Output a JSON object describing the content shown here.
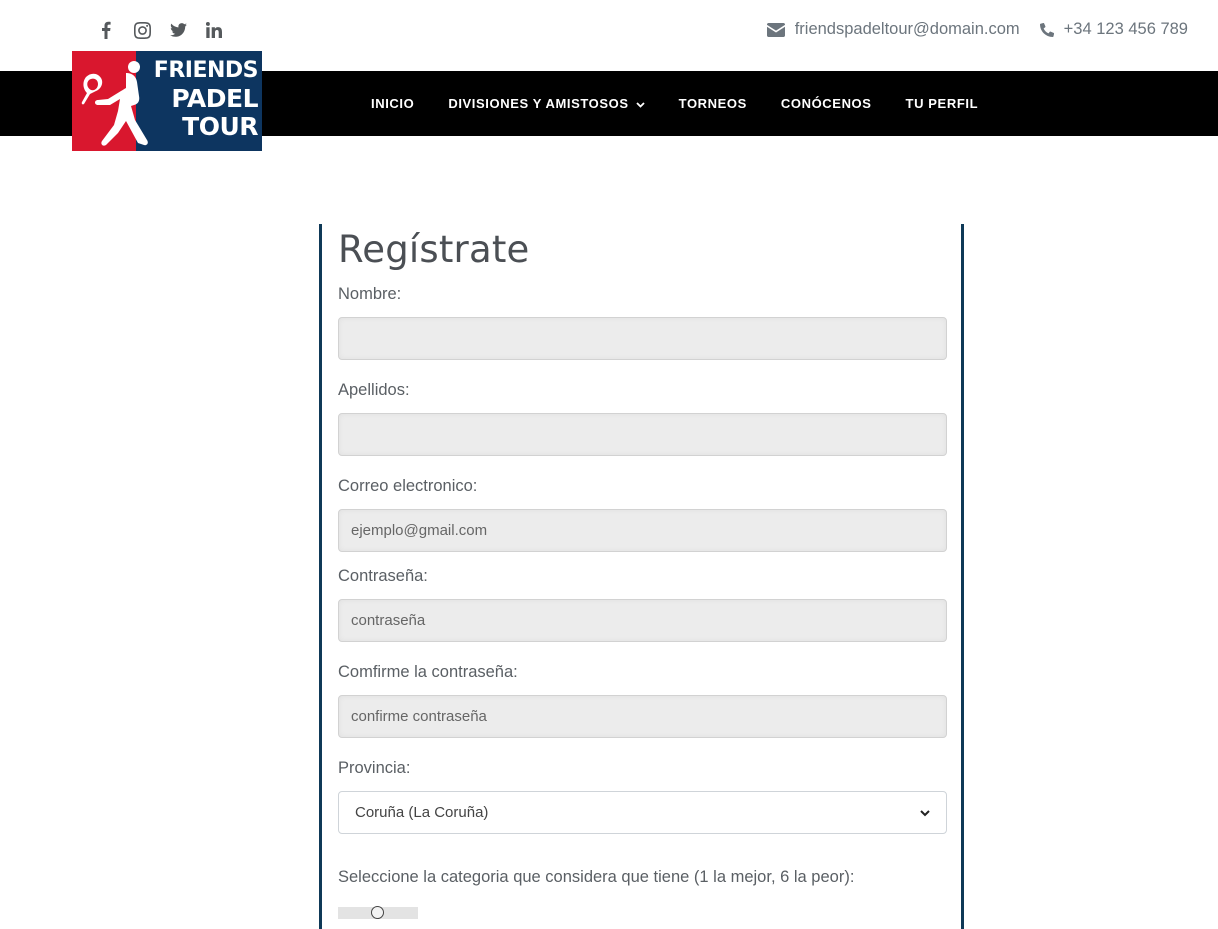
{
  "header": {
    "social_icons": [
      "facebook-icon",
      "instagram-icon",
      "twitter-icon",
      "linkedin-icon"
    ],
    "email": "friendspadeltour@domain.com",
    "phone": "+34 123 456 789",
    "logo": {
      "line1": "FRIENDS",
      "line2": "PADEL",
      "line3": "TOUR"
    }
  },
  "nav": {
    "items": [
      "INICIO",
      "DIVISIONES Y AMISTOSOS",
      "TORNEOS",
      "CONÓCENOS",
      "TU PERFIL"
    ]
  },
  "colors": {
    "nav_bg": "#000000",
    "logo_blue": "#0d3560",
    "logo_red": "#d9172e",
    "form_border": "#0f3957"
  },
  "form": {
    "title": "Regístrate",
    "nombre": {
      "label": "Nombre:",
      "value": ""
    },
    "apellidos": {
      "label": "Apellidos:",
      "value": ""
    },
    "email": {
      "label": "Correo electronico:",
      "placeholder": "ejemplo@gmail.com"
    },
    "password": {
      "label": "Contraseña:",
      "placeholder": "contraseña"
    },
    "confirm": {
      "label": "Comfirme la contraseña:",
      "placeholder": "confirme contraseña"
    },
    "provincia": {
      "label": "Provincia:",
      "selected": "Coruña (La Coruña)"
    },
    "categoria": {
      "label": "Seleccione la categoria que considera que tiene (1 la mejor, 6 la peor):"
    }
  }
}
